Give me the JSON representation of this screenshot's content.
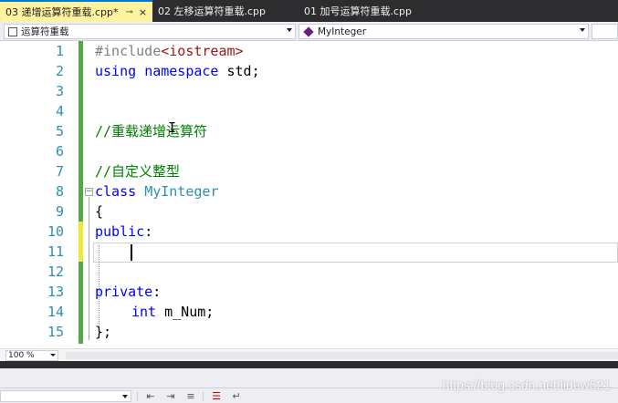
{
  "tabs": [
    {
      "label": "03 递增运算符重载.cpp*",
      "pin": "⊸",
      "close": "×"
    },
    {
      "label": "02 左移运算符重载.cpp"
    },
    {
      "label": "01 加号运算符重载.cpp"
    }
  ],
  "navbar": {
    "scope": "运算符重载",
    "member": "MyInteger"
  },
  "editor": {
    "lines": [
      "1",
      "2",
      "3",
      "4",
      "5",
      "6",
      "7",
      "8",
      "9",
      "10",
      "11",
      "12",
      "13",
      "14",
      "15"
    ],
    "code": {
      "l1_pp": "#include",
      "l1_str": "<iostream>",
      "l2_kw1": "using",
      "l2_kw2": "namespace",
      "l2_rest": " std;",
      "l5": "//重载递增运算符",
      "l7": "//自定义整型",
      "l8_kw": "class",
      "l8_type": "MyInteger",
      "l9": "{",
      "l10_kw": "public",
      "l10_rest": ":",
      "l13_kw": "private",
      "l13_rest": ":",
      "l14_kw": "int",
      "l14_rest": " m_Num;",
      "l15": "};"
    }
  },
  "zoom": "100 %",
  "watermark": "https://blog.csdn.net/lidew521",
  "colors": {
    "tab_active_bg": "#fff3a0",
    "keyword": "#0000ff",
    "type": "#2b91af",
    "comment": "#008000",
    "change_bar": "#57a64a"
  }
}
